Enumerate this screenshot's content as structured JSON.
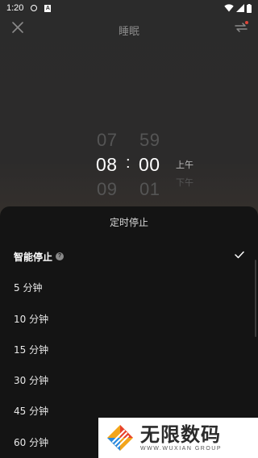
{
  "status_bar": {
    "time": "1:20",
    "a_badge": "A",
    "icons": [
      "sync-ring-icon",
      "a-badge-icon",
      "wifi-icon",
      "cellular-icon",
      "battery-icon"
    ]
  },
  "top_bar": {
    "title": "睡眠",
    "close_icon": "close-icon",
    "mode_icon": "swap-icon"
  },
  "time_picker": {
    "hours": [
      "07",
      "08",
      "09"
    ],
    "minutes": [
      "59",
      "00",
      "01"
    ],
    "selected_hour": "08",
    "selected_minute": "00",
    "separator": ":",
    "am_pm": [
      "上午",
      "下午"
    ],
    "selected_am_pm": "上午"
  },
  "sheet": {
    "title": "定时停止",
    "options": [
      {
        "label": "智能停止",
        "help": "?",
        "selected": true
      },
      {
        "label": "5 分钟",
        "selected": false
      },
      {
        "label": "10 分钟",
        "selected": false
      },
      {
        "label": "15 分钟",
        "selected": false
      },
      {
        "label": "30 分钟",
        "selected": false
      },
      {
        "label": "45 分钟",
        "selected": false
      },
      {
        "label": "60 分钟",
        "selected": false
      }
    ]
  },
  "watermark": {
    "main": "无限数码",
    "sub": "WWW.WUXIAN GROUP"
  },
  "colors": {
    "sheet_bg": "#141414",
    "text_primary": "#ffffff",
    "text_dim": "#555555"
  }
}
